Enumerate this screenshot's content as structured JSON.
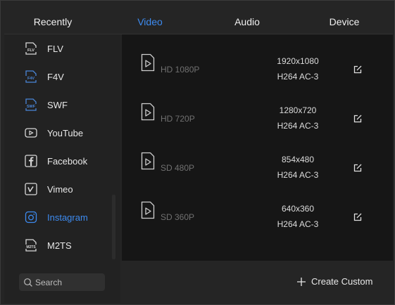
{
  "tabs": [
    {
      "label": "Recently"
    },
    {
      "label": "Video"
    },
    {
      "label": "Audio"
    },
    {
      "label": "Device"
    }
  ],
  "active_tab": "Video",
  "sidebar": {
    "items": [
      {
        "label": "FLV",
        "icon": "flv-file-icon"
      },
      {
        "label": "F4V",
        "icon": "f4v-file-icon"
      },
      {
        "label": "SWF",
        "icon": "swf-file-icon"
      },
      {
        "label": "YouTube",
        "icon": "youtube-icon"
      },
      {
        "label": "Facebook",
        "icon": "facebook-icon"
      },
      {
        "label": "Vimeo",
        "icon": "vimeo-icon"
      },
      {
        "label": "Instagram",
        "icon": "instagram-icon"
      },
      {
        "label": "M2TS",
        "icon": "m2ts-file-icon"
      }
    ],
    "active": "Instagram",
    "search_placeholder": "Search"
  },
  "presets": [
    {
      "name": "HD 1080P",
      "resolution": "1920x1080",
      "codec": "H264  AC-3"
    },
    {
      "name": "HD 720P",
      "resolution": "1280x720",
      "codec": "H264  AC-3"
    },
    {
      "name": "SD 480P",
      "resolution": "854x480",
      "codec": "H264  AC-3"
    },
    {
      "name": "SD 360P",
      "resolution": "640x360",
      "codec": "H264  AC-3"
    }
  ],
  "footer": {
    "create_label": "Create Custom"
  },
  "colors": {
    "accent": "#3d8bf0",
    "panel": "#252525",
    "main_bg": "#161616"
  }
}
